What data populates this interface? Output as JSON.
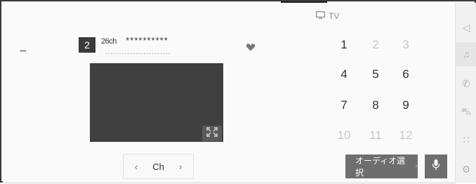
{
  "source": {
    "label": "TV",
    "icon": "tv-icon"
  },
  "channel": {
    "preset_number": "2",
    "number_label": "26ch",
    "name": "**********",
    "info_placeholder": "••••••••••••••••••••••••"
  },
  "keypad": {
    "keys": [
      "1",
      "2",
      "3",
      "4",
      "5",
      "6",
      "7",
      "8",
      "9",
      "10",
      "11",
      "12"
    ]
  },
  "controls": {
    "prev_label": "‹",
    "next_label": "›",
    "channel_label": "Ch",
    "audio_select_label": "オーディオ選択",
    "audio_select_indicator": "•",
    "more_label": "•••"
  },
  "sidebar": {
    "items": [
      {
        "icon": "navigation-icon",
        "glyph": "◁"
      },
      {
        "icon": "music-icon",
        "glyph": "♫"
      },
      {
        "icon": "phone-icon",
        "glyph": "✆"
      },
      {
        "icon": "car-icon",
        "glyph": "⛍"
      },
      {
        "icon": "apps-icon",
        "glyph": "∷"
      },
      {
        "icon": "settings-icon",
        "glyph": "⚙"
      }
    ]
  },
  "colors": {
    "accent_dark": "#3b3b3b",
    "button_gray": "#6e6e6e",
    "video_bg": "#404040"
  }
}
